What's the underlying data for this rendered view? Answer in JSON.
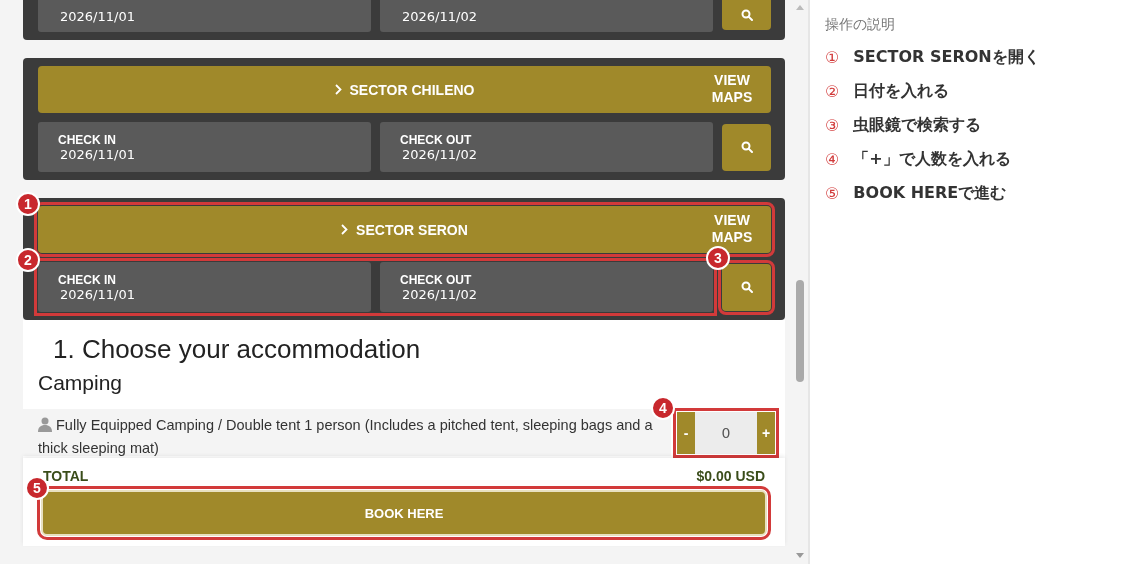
{
  "sectors": [
    {
      "check_in": "2026/11/01",
      "check_out": "2026/11/02",
      "cut": true
    },
    {
      "name": "SECTOR CHILENO",
      "view_maps": "VIEW MAPS",
      "check_in_label": "CHECK IN",
      "check_in": "2026/11/01",
      "check_out_label": "CHECK OUT",
      "check_out": "2026/11/02",
      "cut": false
    },
    {
      "name": "SECTOR SERON",
      "view_maps": "VIEW MAPS",
      "check_in_label": "CHECK IN",
      "check_in": "2026/11/01",
      "check_out_label": "CHECK OUT",
      "check_out": "2026/11/02",
      "cut": false,
      "header_badge": "1",
      "dates_badge": "2",
      "search_badge": "3"
    }
  ],
  "booking": {
    "heading": "1. Choose your accommodation",
    "category": "Camping",
    "items": [
      {
        "description": "Fully Equipped Camping / Double tent 1 person (Includes a pitched tent, sleeping bags and a thick sleeping mat)",
        "minus": "-",
        "quantity": "0",
        "plus": "+",
        "badge": "4"
      }
    ],
    "total_label": "TOTAL",
    "total": "$0.00 USD",
    "book_button": "BOOK HERE",
    "book_badge": "5"
  },
  "instructions": {
    "title": "操作の説明",
    "steps": [
      {
        "number": "①",
        "text": "SECTOR SERONを開く"
      },
      {
        "number": "②",
        "text": "日付を入れる"
      },
      {
        "number": "③",
        "text": "虫眼鏡で検索する"
      },
      {
        "number": "④",
        "text": "「+」で人数を入れる"
      },
      {
        "number": "⑤",
        "text": "BOOK HEREで進む"
      }
    ]
  }
}
